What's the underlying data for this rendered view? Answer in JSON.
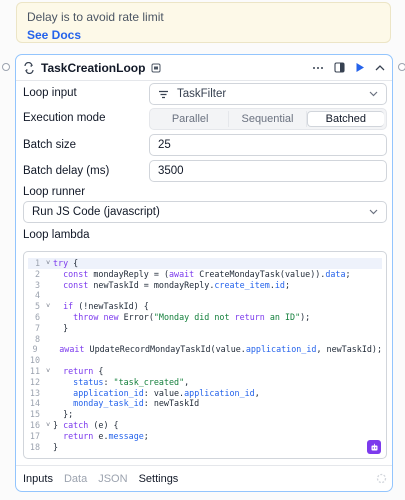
{
  "notice": {
    "message": "Delay is to avoid rate limit",
    "link": "See Docs"
  },
  "node": {
    "title": "TaskCreationLoop"
  },
  "fields": {
    "loop_input_label": "Loop input",
    "loop_input_value": "TaskFilter",
    "execution_mode_label": "Execution mode",
    "modes": [
      "Parallel",
      "Sequential",
      "Batched"
    ],
    "selected_mode": "Batched",
    "batch_size_label": "Batch size",
    "batch_size_value": "25",
    "batch_delay_label": "Batch delay (ms)",
    "batch_delay_value": "3500",
    "loop_runner_label": "Loop runner",
    "loop_runner_value": "Run JS Code (javascript)",
    "loop_lambda_label": "Loop lambda"
  },
  "code": {
    "active_line": 1,
    "lines": [
      "try {",
      "  const mondayReply = (await CreateMondayTask(value)).data;",
      "  const newTaskId = mondayReply.create_item.id;",
      "",
      "  if (!newTaskId) {",
      "    throw new Error(\"Monday did not return an ID\");",
      "  }",
      "",
      "  await UpdateRecordMondayTaskId(value.application_id, newTaskId);",
      "",
      "  return {",
      "    status: \"task_created\",",
      "    application_id: value.application_id,",
      "    monday_task_id: newTaskId",
      "  };",
      "} catch (e) {",
      "  return e.message;",
      "}"
    ]
  },
  "footer": {
    "tabs": [
      "Inputs",
      "Data",
      "JSON",
      "Settings"
    ]
  },
  "colors": {
    "accent": "#2563eb",
    "card_border": "#93c5fd",
    "notice_bg": "#fdf9e8",
    "ai_button": "#7c3aed"
  }
}
